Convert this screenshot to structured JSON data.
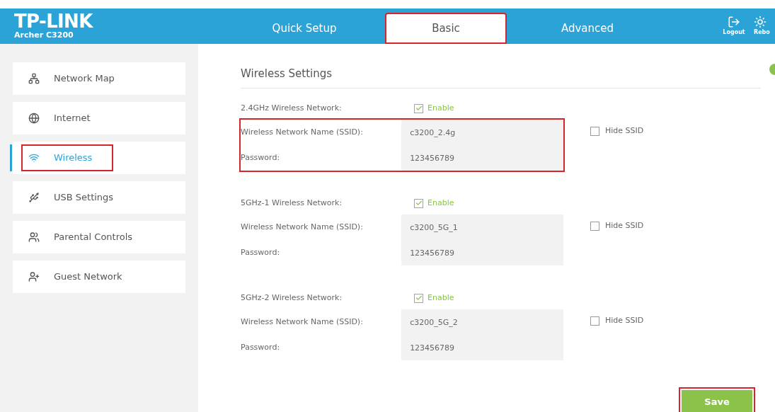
{
  "header": {
    "brand": "TP-LINK",
    "model": "Archer C3200",
    "tabs": [
      {
        "label": "Quick Setup",
        "selected": false,
        "highlighted": false
      },
      {
        "label": "Basic",
        "selected": true,
        "highlighted": true
      },
      {
        "label": "Advanced",
        "selected": false,
        "highlighted": false
      }
    ],
    "actions": [
      {
        "kind": "logout",
        "label": "Logout"
      },
      {
        "kind": "reboot",
        "label": "Rebo"
      }
    ]
  },
  "sidebar": {
    "items": [
      {
        "kind": "network-map",
        "label": "Network Map",
        "selected": false,
        "highlighted": false
      },
      {
        "kind": "internet",
        "label": "Internet",
        "selected": false,
        "highlighted": false
      },
      {
        "kind": "wireless",
        "label": "Wireless",
        "selected": true,
        "highlighted": true
      },
      {
        "kind": "usb",
        "label": "USB Settings",
        "selected": false,
        "highlighted": false
      },
      {
        "kind": "parental",
        "label": "Parental Controls",
        "selected": false,
        "highlighted": false
      },
      {
        "kind": "guest",
        "label": "Guest Network",
        "selected": false,
        "highlighted": false
      }
    ]
  },
  "content": {
    "title": "Wireless Settings",
    "bands": [
      {
        "label": "2.4GHz Wireless Network:",
        "enable": {
          "label": "Enable",
          "checked": true
        },
        "ssid_label": "Wireless Network Name (SSID):",
        "ssid": "c3200_2.4g",
        "hide": {
          "label": "Hide SSID",
          "checked": false
        },
        "password_label": "Password:",
        "password": "123456789",
        "highlighted": true
      },
      {
        "label": "5GHz-1 Wireless Network:",
        "enable": {
          "label": "Enable",
          "checked": true
        },
        "ssid_label": "Wireless Network Name (SSID):",
        "ssid": "c3200_5G_1",
        "hide": {
          "label": "Hide SSID",
          "checked": false
        },
        "password_label": "Password:",
        "password": "123456789",
        "highlighted": false
      },
      {
        "label": "5GHz-2 Wireless Network:",
        "enable": {
          "label": "Enable",
          "checked": true
        },
        "ssid_label": "Wireless Network Name (SSID):",
        "ssid": "c3200_5G_2",
        "hide": {
          "label": "Hide SSID",
          "checked": false
        },
        "password_label": "Password:",
        "password": "123456789",
        "highlighted": false
      }
    ],
    "save": {
      "label": "Save",
      "highlighted": true
    }
  }
}
